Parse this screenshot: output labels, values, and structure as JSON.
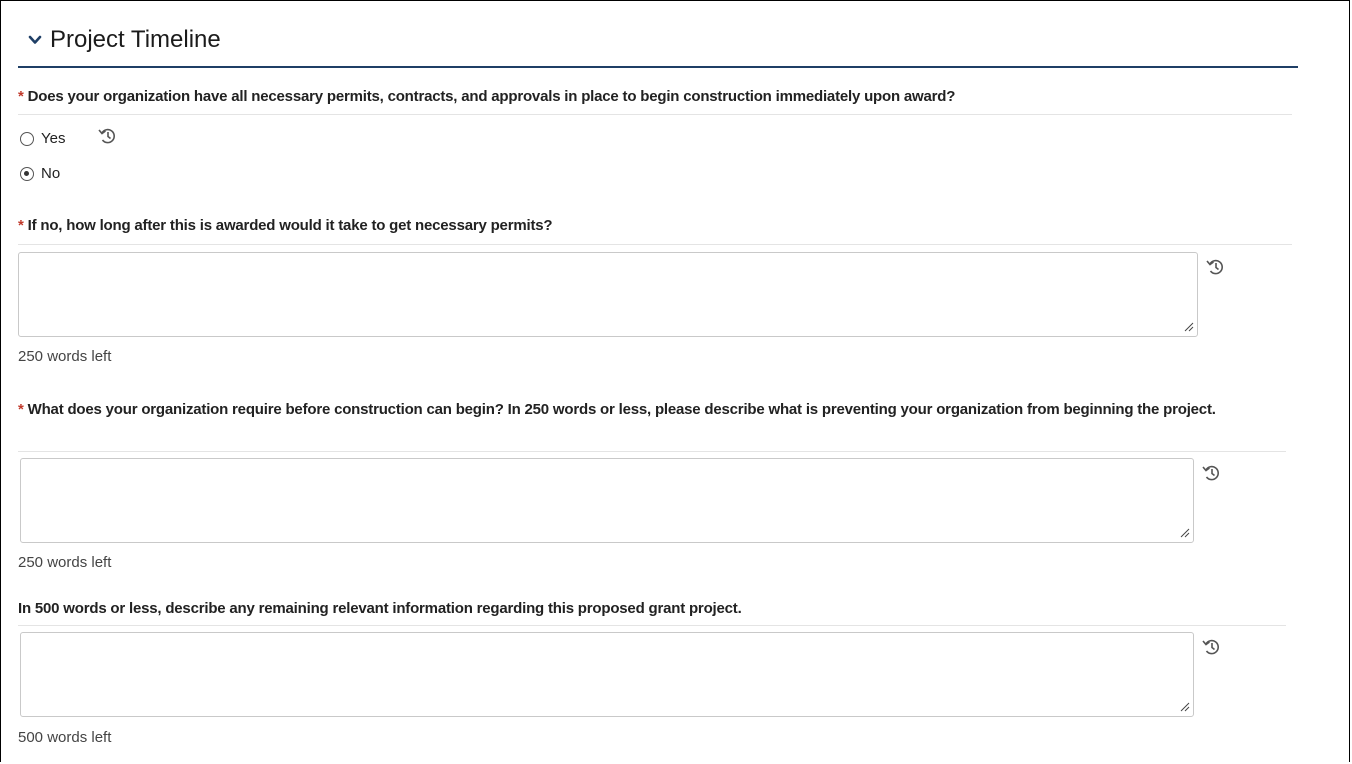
{
  "section": {
    "title": "Project Timeline"
  },
  "questions": [
    {
      "required": "*",
      "text": "Does your organization have all necessary permits, contracts, and approvals in place to begin construction immediately upon award?"
    },
    {
      "required": "*",
      "text": "If no, how long after this is awarded would it take to get necessary permits?"
    },
    {
      "required": "*",
      "text": "What does your organization require before construction can begin? In 250 words or less, please describe what is preventing your organization from beginning the project."
    },
    {
      "required": "",
      "text": "In 500 words or less, describe any remaining relevant information regarding this proposed grant project."
    }
  ],
  "radio": {
    "yes_label": "Yes",
    "no_label": "No",
    "selected": "No"
  },
  "fields": [
    {
      "value": "",
      "words_left": "250 words left"
    },
    {
      "value": "",
      "words_left": "250 words left"
    },
    {
      "value": "",
      "words_left": "500 words left"
    }
  ],
  "colors": {
    "required": "#c0392b",
    "header_rule": "#1f3f66",
    "chevron": "#1f3f66"
  },
  "icons": {
    "collapse": "chevron-down-icon",
    "history": "history-icon",
    "resize": "resize-grip-icon"
  }
}
